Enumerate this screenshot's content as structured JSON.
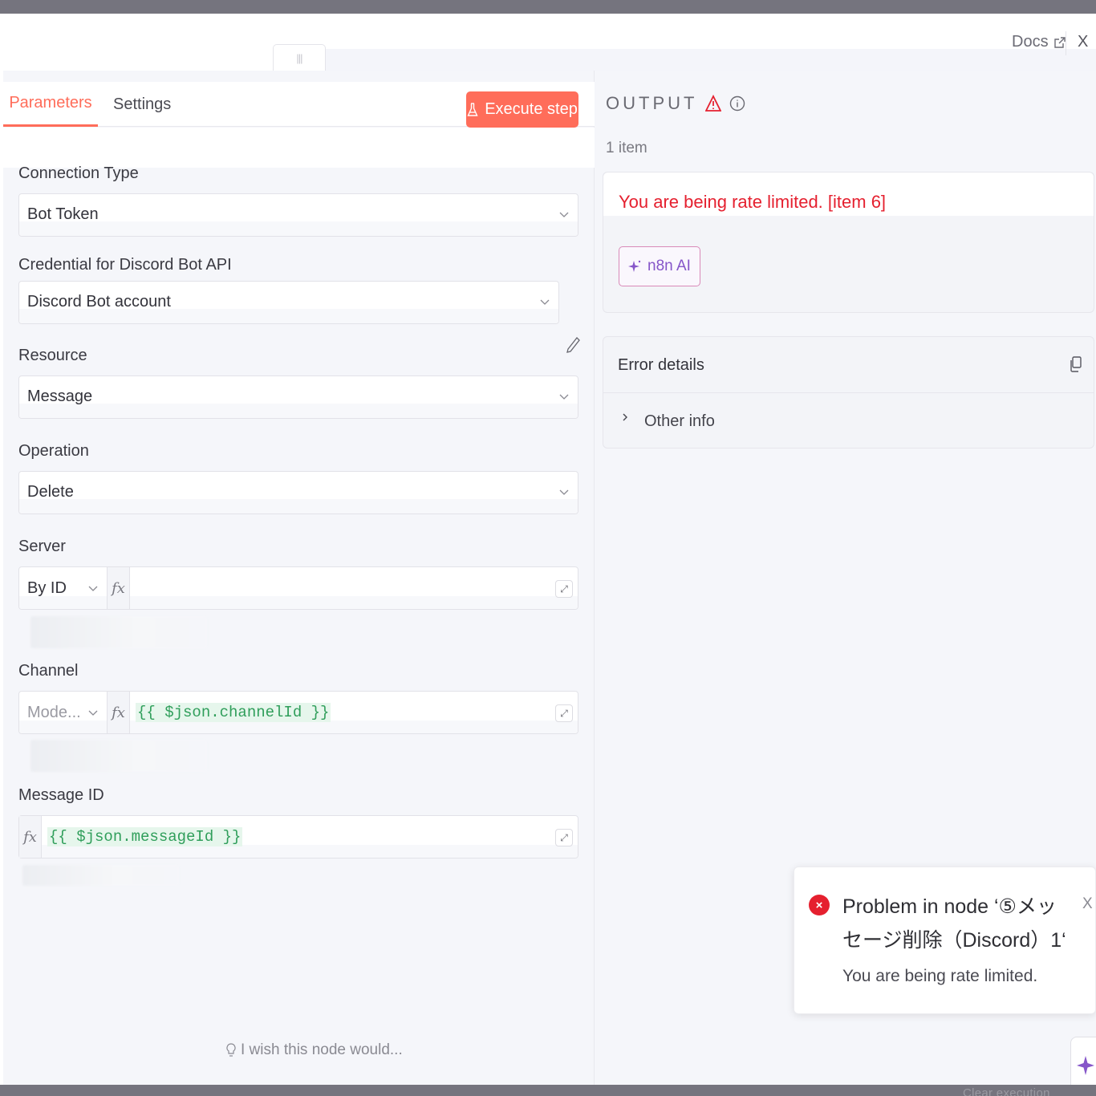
{
  "header": {
    "docs_label": "Docs",
    "close_label": "X",
    "drag_handle_label": "|||"
  },
  "tabs": {
    "parameters": "Parameters",
    "settings": "Settings",
    "execute": "Execute step"
  },
  "fields": {
    "connection_type": {
      "label": "Connection Type",
      "value": "Bot Token"
    },
    "credential": {
      "label": "Credential for Discord Bot API",
      "value": "Discord Bot account"
    },
    "resource": {
      "label": "Resource",
      "value": "Message"
    },
    "operation": {
      "label": "Operation",
      "value": "Delete"
    },
    "server": {
      "label": "Server",
      "mode": "By ID",
      "fx": "fx"
    },
    "channel": {
      "label": "Channel",
      "mode": "Mode...",
      "fx": "fx",
      "expression": "{{ $json.channelId }}"
    },
    "message_id": {
      "label": "Message ID",
      "fx": "fx",
      "expression": "{{ $json.messageId }}"
    }
  },
  "wish": "I wish this node would...",
  "output": {
    "title": "OUTPUT",
    "items": "1 item",
    "error_message": "You are being rate limited. [item 6]",
    "ai_button": "n8n AI",
    "details_title": "Error details",
    "other_info": "Other info"
  },
  "toast": {
    "icon": "×",
    "title": "Problem in node ‘⑤メッセージ削除（Discord）1‘",
    "body": "You are being rate limited.",
    "close": "X"
  },
  "footer": {
    "clear_execution": "Clear execution"
  },
  "colors": {
    "accent": "#ff6d5a",
    "error": "#e5202f",
    "expression": "#2f9e5a",
    "ai": "#8656c9"
  },
  "icons": {
    "docs": "external-link-icon",
    "execute": "flask-icon",
    "warning": "warning-triangle-icon",
    "info": "info-circle-icon",
    "ai": "sparkle-icon",
    "copy": "copy-icon",
    "pencil": "pencil-icon",
    "bulb": "lightbulb-icon"
  }
}
